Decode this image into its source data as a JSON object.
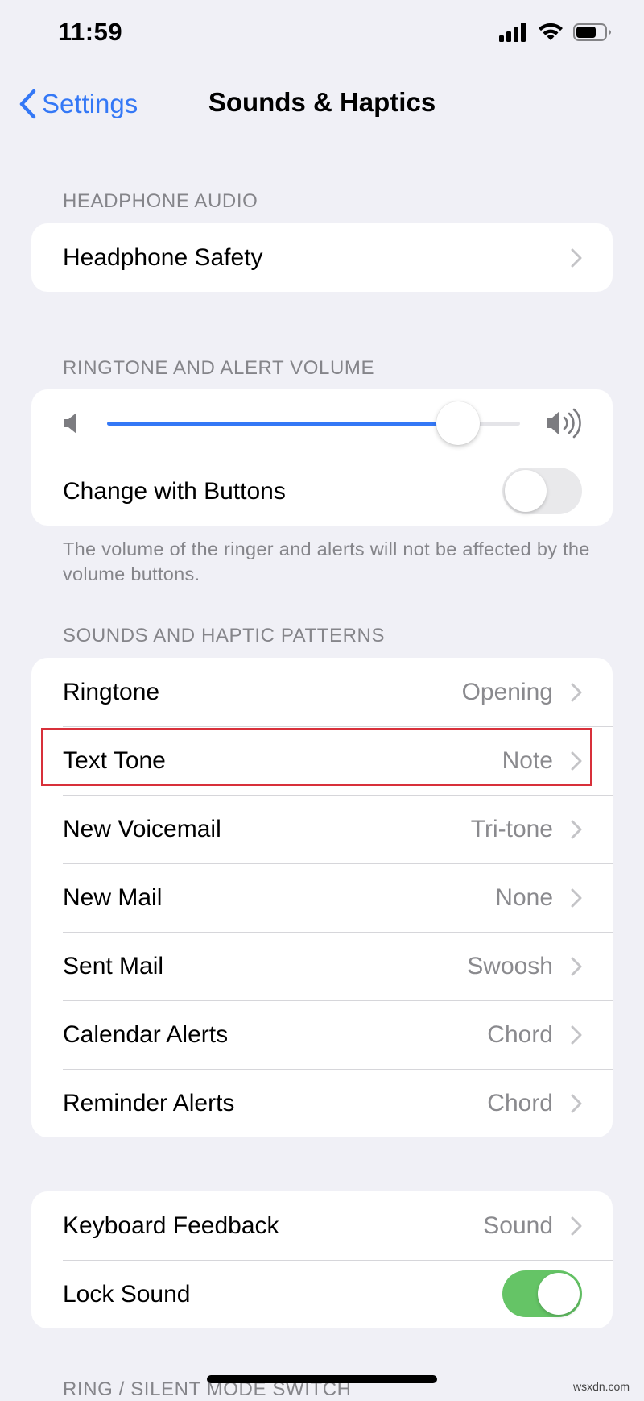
{
  "status_bar": {
    "time": "11:59",
    "icons": [
      "signal-icon",
      "wifi-icon",
      "battery-icon"
    ]
  },
  "nav": {
    "back_label": "Settings",
    "title": "Sounds & Haptics"
  },
  "sections": {
    "headphone": {
      "header": "HEADPHONE AUDIO",
      "items": [
        {
          "label": "Headphone Safety"
        }
      ]
    },
    "volume": {
      "header": "RINGTONE AND ALERT VOLUME",
      "slider_level": 0.85,
      "change_with_buttons_label": "Change with Buttons",
      "change_with_buttons_on": false,
      "footnote": "The volume of the ringer and alerts will not be affected by the volume buttons."
    },
    "patterns": {
      "header": "SOUNDS AND HAPTIC PATTERNS",
      "items": [
        {
          "label": "Ringtone",
          "value": "Opening"
        },
        {
          "label": "Text Tone",
          "value": "Note"
        },
        {
          "label": "New Voicemail",
          "value": "Tri-tone"
        },
        {
          "label": "New Mail",
          "value": "None"
        },
        {
          "label": "Sent Mail",
          "value": "Swoosh"
        },
        {
          "label": "Calendar Alerts",
          "value": "Chord"
        },
        {
          "label": "Reminder Alerts",
          "value": "Chord"
        }
      ]
    },
    "feedback": {
      "keyboard_label": "Keyboard Feedback",
      "keyboard_value": "Sound",
      "lock_sound_label": "Lock Sound",
      "lock_sound_on": true
    },
    "ring_silent": {
      "header": "RING / SILENT MODE SWITCH"
    }
  },
  "watermark": "wsxdn.com",
  "colors": {
    "accent": "#3478f6",
    "toggle_on": "#65c466",
    "toggle_off": "#e9e9eb",
    "highlight": "#d8303a",
    "background": "#f0f0f6"
  }
}
